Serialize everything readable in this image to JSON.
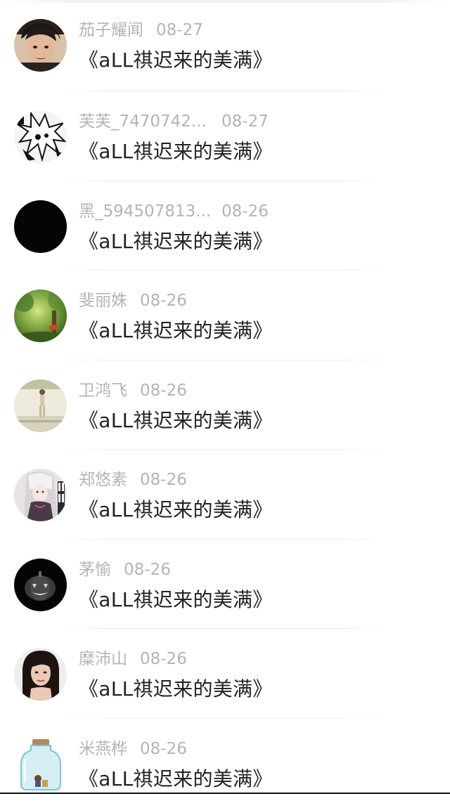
{
  "comments": [
    {
      "user": "茄子耀闻",
      "date": "08-27",
      "text": "《aLL祺迟来的美满》",
      "avatar_icon": "photo-avatar-boy"
    },
    {
      "user": "芙芙_7470742...",
      "date": "08-27",
      "text": "《aLL祺迟来的美满》",
      "avatar_icon": "manga-avatar"
    },
    {
      "user": "黑_594507813...",
      "date": "08-26",
      "text": "《aLL祺迟来的美满》",
      "avatar_icon": "black-avatar"
    },
    {
      "user": "斐丽姝",
      "date": "08-26",
      "text": "《aLL祺迟来的美满》",
      "avatar_icon": "forest-avatar"
    },
    {
      "user": "卫鸿飞",
      "date": "08-26",
      "text": "《aLL祺迟来的美满》",
      "avatar_icon": "figure-avatar"
    },
    {
      "user": "郑悠素",
      "date": "08-26",
      "text": "《aLL祺迟来的美满》",
      "avatar_icon": "anime-girl-avatar"
    },
    {
      "user": "茅愉",
      "date": "08-26",
      "text": "《aLL祺迟来的美满》",
      "avatar_icon": "pumpkin-avatar"
    },
    {
      "user": "糜沛山",
      "date": "08-26",
      "text": "《aLL祺迟来的美满》",
      "avatar_icon": "woman-portrait-avatar"
    },
    {
      "user": "米燕桦",
      "date": "08-26",
      "text": "《aLL祺迟来的美满》",
      "avatar_icon": "bottle-avatar"
    }
  ],
  "colors": {
    "username": "#b4b4b4",
    "date": "#b4b4b4",
    "comment_text": "#222222",
    "background": "#ffffff"
  }
}
